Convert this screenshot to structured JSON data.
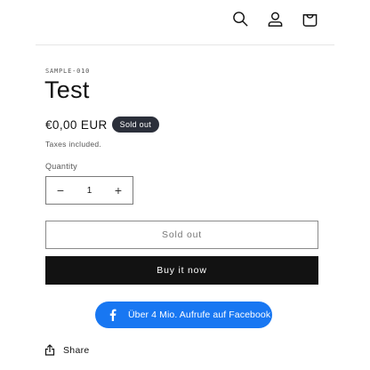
{
  "header": {
    "icons": [
      "search-icon",
      "account-icon",
      "cart-icon"
    ]
  },
  "product": {
    "vendor": "SAMPLE-010",
    "title": "Test",
    "price": "€0,00 EUR",
    "badge": "Sold out",
    "taxes_note": "Taxes included.",
    "quantity_label": "Quantity",
    "quantity_value": "1",
    "decrease_symbol": "−",
    "increase_symbol": "+"
  },
  "actions": {
    "sold_out_label": "Sold out",
    "buy_now_label": "Buy it now"
  },
  "facebook": {
    "label": "Über 4 Mio. Aufrufe auf Facebook",
    "color": "#1877f2"
  },
  "share": {
    "label": "Share"
  },
  "colors": {
    "badge_bg": "#2b2f3a",
    "buy_button_bg": "#121212"
  }
}
